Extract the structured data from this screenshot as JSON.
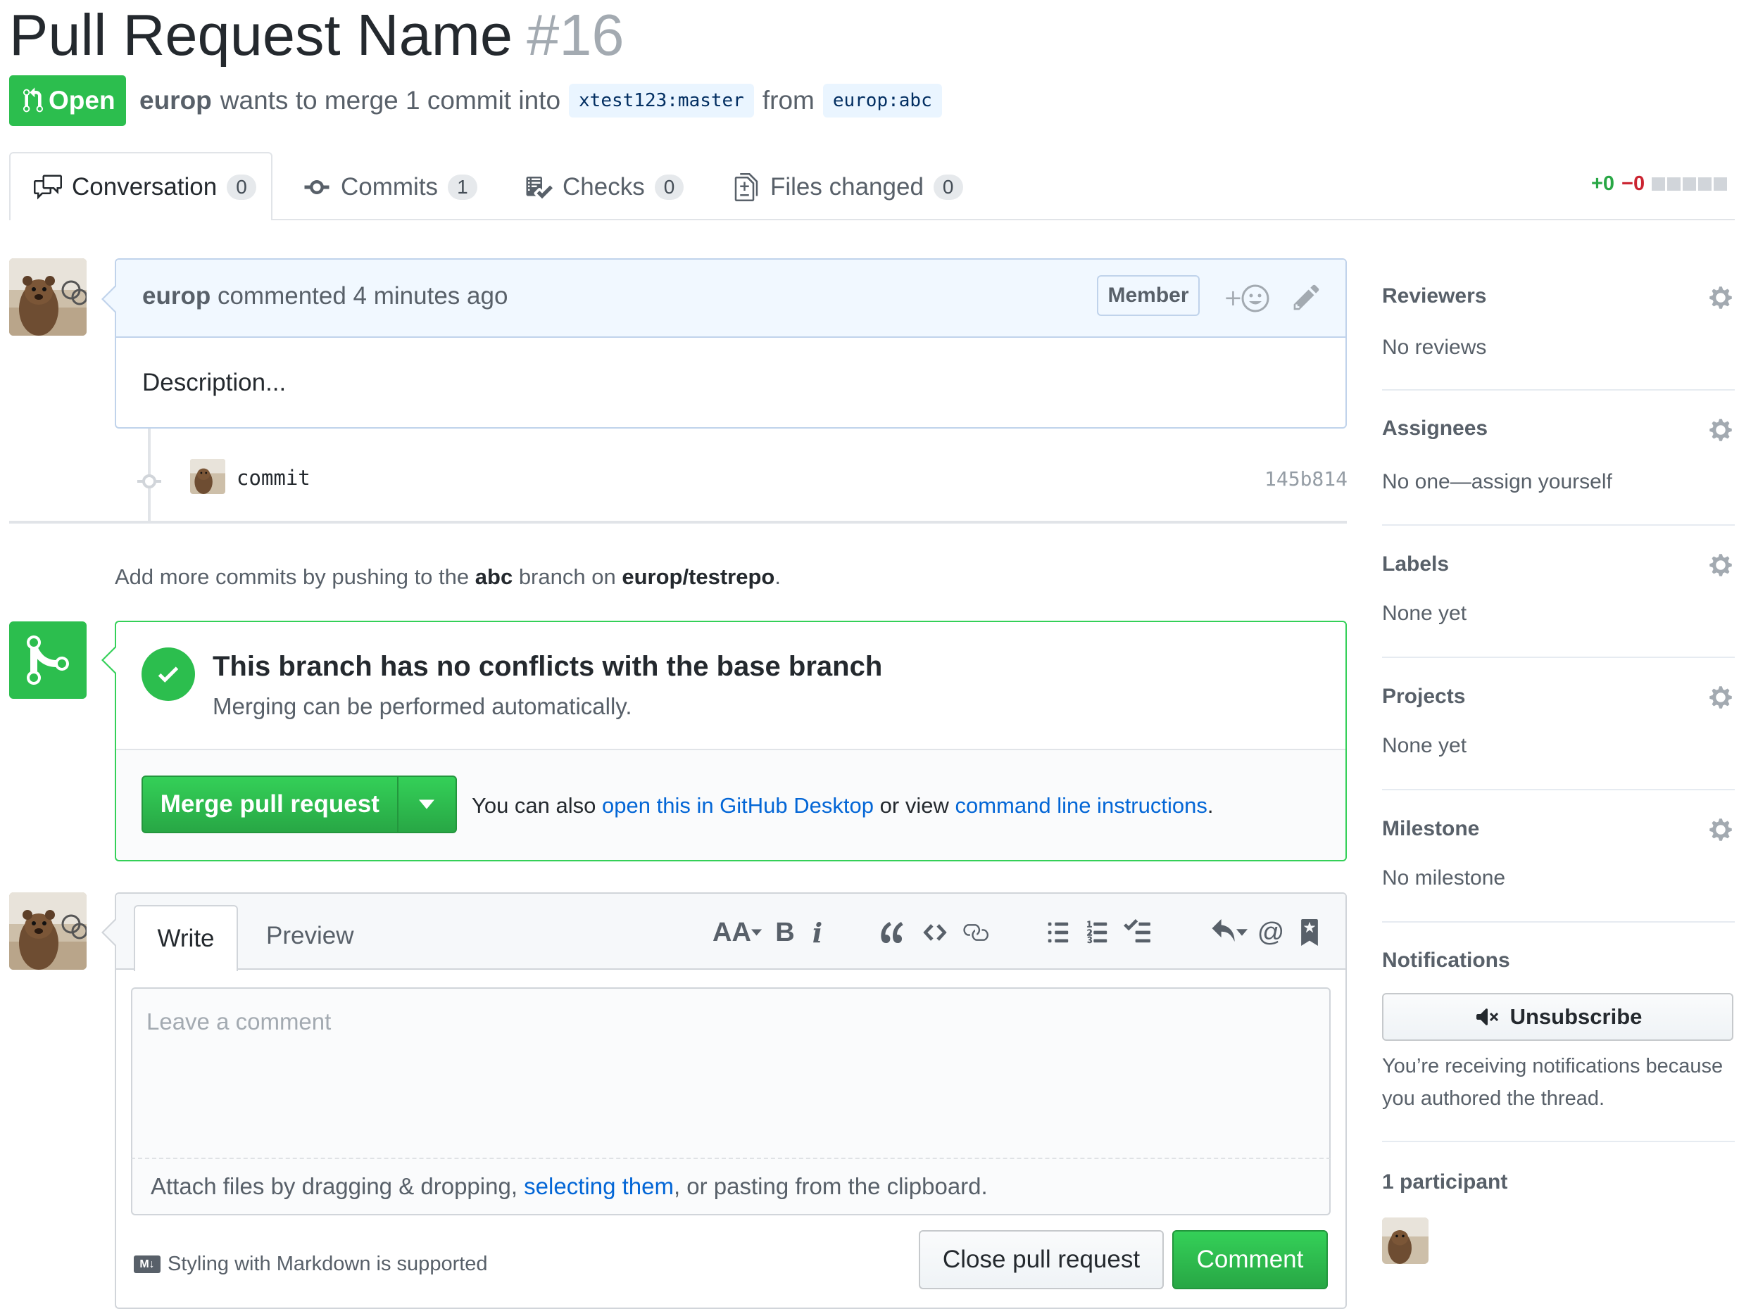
{
  "pr": {
    "title": "Pull Request Name",
    "number": "#16",
    "state": "Open",
    "author": "europ",
    "merge_text": "wants to merge 1 commit into",
    "base_branch": "xtest123:master",
    "from_text": "from",
    "head_branch": "europ:abc"
  },
  "tabs": [
    {
      "label": "Conversation",
      "count": "0"
    },
    {
      "label": "Commits",
      "count": "1"
    },
    {
      "label": "Checks",
      "count": "0"
    },
    {
      "label": "Files changed",
      "count": "0"
    }
  ],
  "diffstat": {
    "additions": "+0",
    "deletions": "−0"
  },
  "comment": {
    "author": "europ",
    "action": "commented 4 minutes ago",
    "badge": "Member",
    "body": "Description..."
  },
  "commit": {
    "message": "commit",
    "sha": "145b814"
  },
  "more_commits": {
    "prefix": "Add more commits by pushing to the",
    "branch": "abc",
    "middle": "branch on",
    "repo": "europ/testrepo",
    "suffix": "."
  },
  "merge": {
    "heading": "This branch has no conflicts with the base branch",
    "subtext": "Merging can be performed automatically.",
    "button": "Merge pull request",
    "help_prefix": "You can also",
    "help_link1": "open this in GitHub Desktop",
    "help_middle": "or view",
    "help_link2": "command line instructions",
    "help_suffix": "."
  },
  "editor": {
    "write_tab": "Write",
    "preview_tab": "Preview",
    "placeholder": "Leave a comment",
    "attach_prefix": "Attach files by dragging & dropping,",
    "attach_link": "selecting them",
    "attach_suffix": ", or pasting from the clipboard.",
    "markdown_note": "Styling with Markdown is supported",
    "markdown_icon": "M↓",
    "toolbar": {
      "header": "AA",
      "bold": "B",
      "italic": "i",
      "mention": "@"
    },
    "close_button": "Close pull request",
    "comment_button": "Comment"
  },
  "sidebar": {
    "reviewers": {
      "heading": "Reviewers",
      "value": "No reviews"
    },
    "assignees": {
      "heading": "Assignees",
      "value": "No one—assign yourself"
    },
    "labels": {
      "heading": "Labels",
      "value": "None yet"
    },
    "projects": {
      "heading": "Projects",
      "value": "None yet"
    },
    "milestone": {
      "heading": "Milestone",
      "value": "No milestone"
    },
    "notifications": {
      "heading": "Notifications",
      "button": "Unsubscribe",
      "reason": "You’re receiving notifications because you authored the thread."
    },
    "participants": {
      "heading": "1 participant"
    }
  },
  "colors": {
    "green": "#2cbe4e",
    "link": "#0366d6",
    "header_blue": "#f1f8ff"
  }
}
